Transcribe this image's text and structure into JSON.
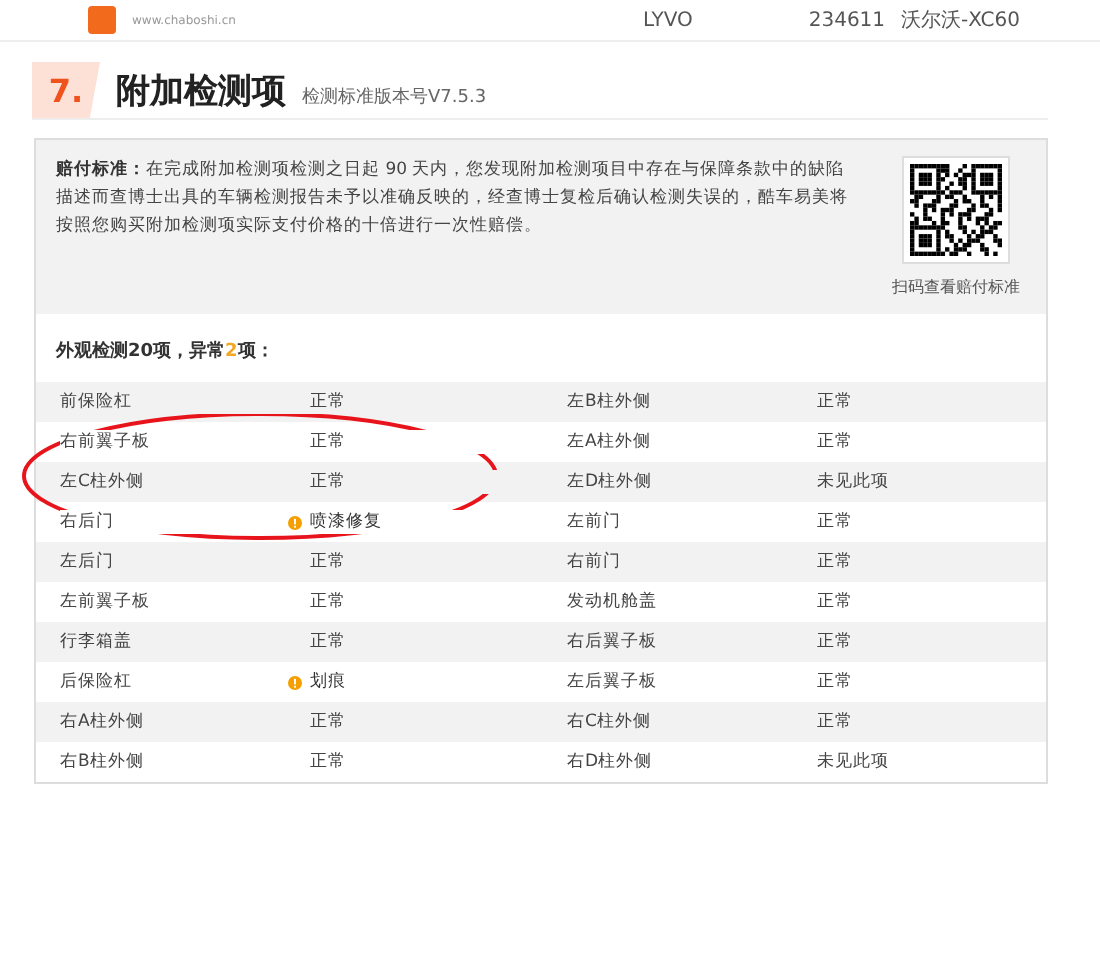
{
  "header": {
    "site": "www.chaboshi.cn",
    "vin_part": "LYVO",
    "mileage": "234611",
    "model": "沃尔沃-XC60"
  },
  "section": {
    "number": "7.",
    "title": "附加检测项",
    "version": "检测标准版本号V7.5.3"
  },
  "compensation": {
    "label": "赔付标准：",
    "text": "在完成附加检测项检测之日起 90 天内，您发现附加检测项目中存在与保障条款中的缺陷描述而查博士出具的车辆检测报告未予以准确反映的，经查博士复检后确认检测失误的，酷车易美将按照您购买附加检测项实际支付价格的十倍进行一次性赔偿。",
    "qr_caption": "扫码查看赔付标准"
  },
  "summary": {
    "prefix": "外观检测20项，异常",
    "count": "2",
    "suffix": "项："
  },
  "rows": [
    [
      {
        "item": "前保险杠",
        "result": "正常",
        "warning": false
      },
      {
        "item": "左B柱外侧",
        "result": "正常",
        "warning": false
      }
    ],
    [
      {
        "item": "右前翼子板",
        "result": "正常",
        "warning": false
      },
      {
        "item": "左A柱外侧",
        "result": "正常",
        "warning": false
      }
    ],
    [
      {
        "item": "左C柱外侧",
        "result": "正常",
        "warning": false
      },
      {
        "item": "左D柱外侧",
        "result": "未见此项",
        "warning": false
      }
    ],
    [
      {
        "item": "右后门",
        "result": "喷漆修复",
        "warning": true
      },
      {
        "item": "左前门",
        "result": "正常",
        "warning": false
      }
    ],
    [
      {
        "item": "左后门",
        "result": "正常",
        "warning": false
      },
      {
        "item": "右前门",
        "result": "正常",
        "warning": false
      }
    ],
    [
      {
        "item": "左前翼子板",
        "result": "正常",
        "warning": false
      },
      {
        "item": "发动机舱盖",
        "result": "正常",
        "warning": false
      }
    ],
    [
      {
        "item": "行李箱盖",
        "result": "正常",
        "warning": false
      },
      {
        "item": "右后翼子板",
        "result": "正常",
        "warning": false
      }
    ],
    [
      {
        "item": "后保险杠",
        "result": "划痕",
        "warning": true
      },
      {
        "item": "左后翼子板",
        "result": "正常",
        "warning": false
      }
    ],
    [
      {
        "item": "右A柱外侧",
        "result": "正常",
        "warning": false
      },
      {
        "item": "右C柱外侧",
        "result": "正常",
        "warning": false
      }
    ],
    [
      {
        "item": "右B柱外侧",
        "result": "正常",
        "warning": false
      },
      {
        "item": "右D柱外侧",
        "result": "未见此项",
        "warning": false
      }
    ]
  ]
}
